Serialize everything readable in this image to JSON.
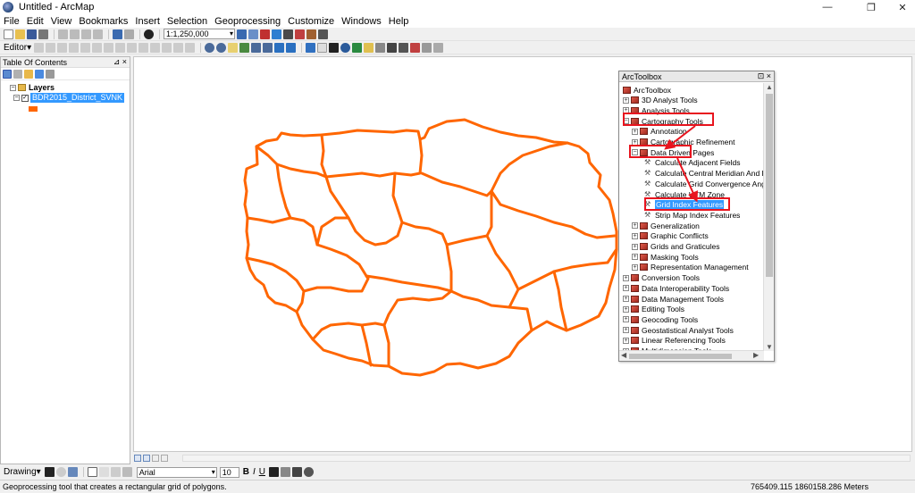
{
  "window": {
    "title": "Untitled - ArcMap",
    "minimize": "—",
    "restore": "❐",
    "close": "✕"
  },
  "menu": [
    "File",
    "Edit",
    "View",
    "Bookmarks",
    "Insert",
    "Selection",
    "Geoprocessing",
    "Customize",
    "Windows",
    "Help"
  ],
  "standard_toolbar": {
    "scale": "1:1,250,000"
  },
  "editor_toolbar": {
    "label": "Editor▾"
  },
  "toc": {
    "title": "Table Of Contents",
    "pin_close": "⊿ ×",
    "layers_group": "Layers",
    "layer_name": "BDR2015_District_SVNK",
    "layer_color": "#ff6600"
  },
  "arctoolbox": {
    "title": "ArcToolbox",
    "controls": "⊡ ×",
    "items": [
      {
        "label": "ArcToolbox",
        "type": "root",
        "level": 0
      },
      {
        "label": "3D Analyst Tools",
        "type": "box",
        "level": 1,
        "exp": "+"
      },
      {
        "label": "Analysis Tools",
        "type": "box",
        "level": 1,
        "exp": "+"
      },
      {
        "label": "Cartography Tools",
        "type": "box",
        "level": 1,
        "exp": "−"
      },
      {
        "label": "Annotation",
        "type": "box",
        "level": 2,
        "exp": "+"
      },
      {
        "label": "Cartographic Refinement",
        "type": "box",
        "level": 2,
        "exp": "+"
      },
      {
        "label": "Data Driven Pages",
        "type": "box",
        "level": 2,
        "exp": "−"
      },
      {
        "label": "Calculate Adjacent Fields",
        "type": "tool",
        "level": 3
      },
      {
        "label": "Calculate Central Meridian And P",
        "type": "tool",
        "level": 3
      },
      {
        "label": "Calculate Grid Convergence Ang",
        "type": "tool",
        "level": 3
      },
      {
        "label": "Calculate UTM Zone",
        "type": "tool",
        "level": 3
      },
      {
        "label": "Grid Index Features",
        "type": "tool",
        "level": 3,
        "selected": true
      },
      {
        "label": "Strip Map Index Features",
        "type": "tool",
        "level": 3
      },
      {
        "label": "Generalization",
        "type": "box",
        "level": 2,
        "exp": "+"
      },
      {
        "label": "Graphic Conflicts",
        "type": "box",
        "level": 2,
        "exp": "+"
      },
      {
        "label": "Grids and Graticules",
        "type": "box",
        "level": 2,
        "exp": "+"
      },
      {
        "label": "Masking Tools",
        "type": "box",
        "level": 2,
        "exp": "+"
      },
      {
        "label": "Representation Management",
        "type": "box",
        "level": 2,
        "exp": "+"
      },
      {
        "label": "Conversion Tools",
        "type": "box",
        "level": 1,
        "exp": "+"
      },
      {
        "label": "Data Interoperability Tools",
        "type": "box",
        "level": 1,
        "exp": "+"
      },
      {
        "label": "Data Management Tools",
        "type": "box",
        "level": 1,
        "exp": "+"
      },
      {
        "label": "Editing Tools",
        "type": "box",
        "level": 1,
        "exp": "+"
      },
      {
        "label": "Geocoding Tools",
        "type": "box",
        "level": 1,
        "exp": "+"
      },
      {
        "label": "Geostatistical Analyst Tools",
        "type": "box",
        "level": 1,
        "exp": "+"
      },
      {
        "label": "Linear Referencing Tools",
        "type": "box",
        "level": 1,
        "exp": "+"
      },
      {
        "label": "Multidimension Tools",
        "type": "box",
        "level": 1,
        "exp": "+"
      }
    ],
    "highlight_color": "#e8141e"
  },
  "drawing_toolbar": {
    "label": "Drawing▾",
    "font": "Arial",
    "size": "10",
    "bold": "B",
    "italic": "I",
    "underline": "U"
  },
  "status": {
    "message": "Geoprocessing tool that creates a rectangular grid of polygons.",
    "coords": "765409.115  1860158.286 Meters"
  }
}
